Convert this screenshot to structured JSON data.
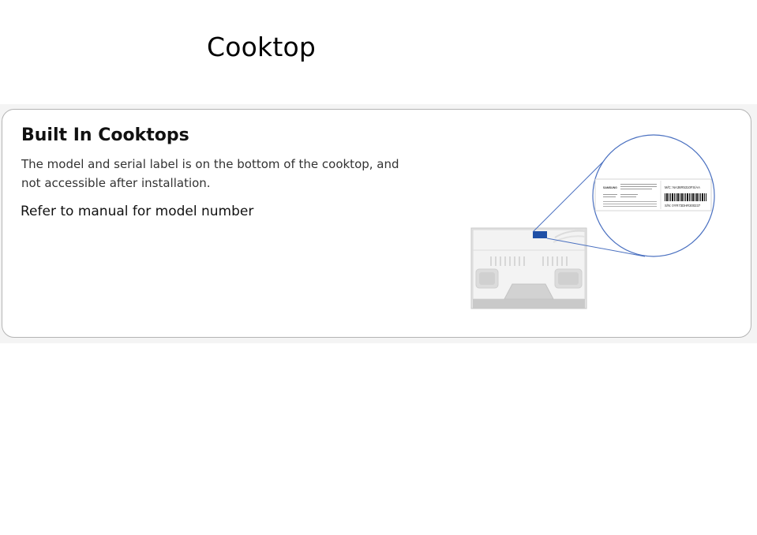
{
  "page": {
    "title": "Cooktop"
  },
  "card": {
    "heading": "Built In Cooktops",
    "description": "The model and serial label is on the bottom of the cooktop, and not accessible after installation.",
    "note": "Refer to manual for model number"
  },
  "illustration": {
    "label": {
      "brand": "SAMSUNG",
      "model_line": "M/C: NA36R5310FS/AA",
      "serial_line": "S/N: 0YR73DHR300237"
    }
  },
  "colors": {
    "label_marker": "#1f4fa6",
    "callout_line": "#4a70c0",
    "card_border": "#b4b4b4",
    "band_background": "#f4f4f4"
  }
}
